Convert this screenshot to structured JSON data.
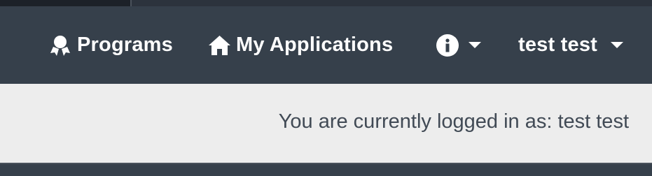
{
  "nav": {
    "programs_label": "Programs",
    "applications_label": "My Applications",
    "user_label": "test test",
    "icons": {
      "programs": "award-ribbon-icon",
      "applications": "home-icon",
      "info": "info-circle-icon",
      "dropdown": "caret-down-icon"
    }
  },
  "status": {
    "logged_in_text": "You are currently logged in as: test test"
  },
  "colors": {
    "navbar_bg": "#36404b",
    "infobar_bg": "#ededed",
    "text_muted": "#414a55"
  }
}
